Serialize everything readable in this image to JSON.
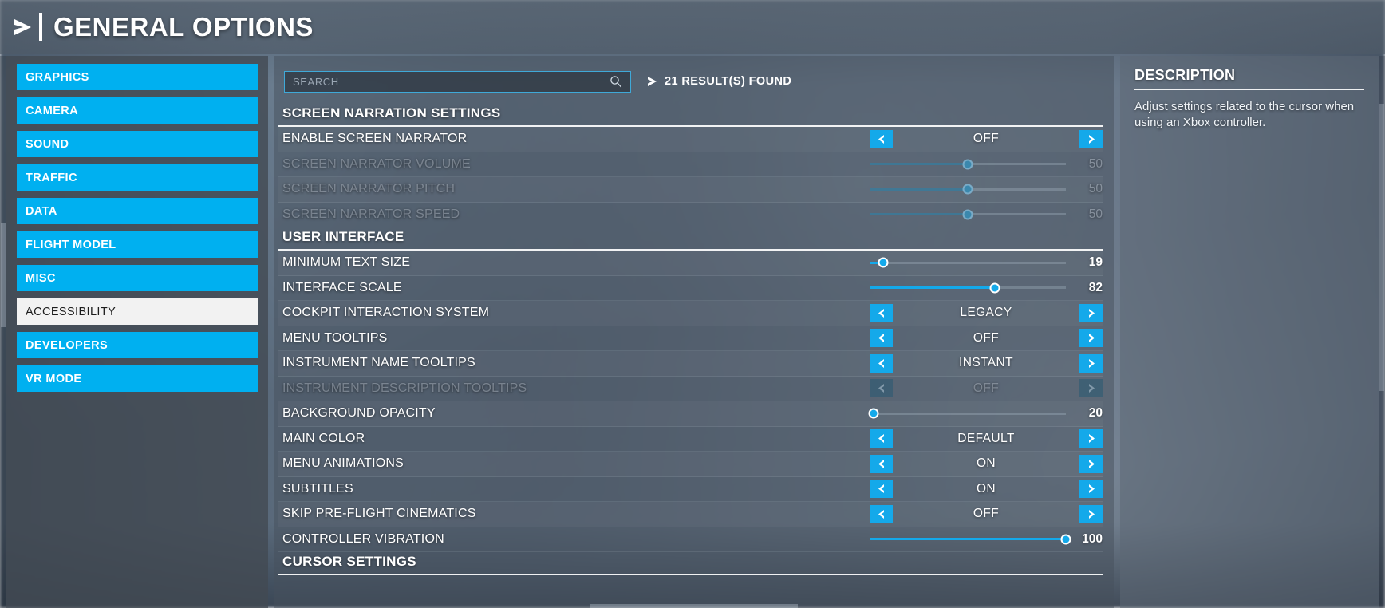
{
  "header": {
    "title": "GENERAL OPTIONS",
    "arrow_icon": "play-arrow-icon"
  },
  "sidebar": {
    "items": [
      {
        "label": "GRAPHICS",
        "selected": false
      },
      {
        "label": "CAMERA",
        "selected": false
      },
      {
        "label": "SOUND",
        "selected": false
      },
      {
        "label": "TRAFFIC",
        "selected": false
      },
      {
        "label": "DATA",
        "selected": false
      },
      {
        "label": "FLIGHT MODEL",
        "selected": false
      },
      {
        "label": "MISC",
        "selected": false
      },
      {
        "label": "ACCESSIBILITY",
        "selected": true
      },
      {
        "label": "DEVELOPERS",
        "selected": false
      },
      {
        "label": "VR MODE",
        "selected": false
      }
    ]
  },
  "search": {
    "value": "",
    "placeholder": "SEARCH",
    "icon": "search-icon",
    "results_label": "21 RESULT(S) FOUND",
    "results_chevron": "chevron-right-icon"
  },
  "sections": [
    {
      "title": "SCREEN NARRATION SETTINGS",
      "rows": [
        {
          "label": "ENABLE SCREEN NARRATOR",
          "type": "option",
          "value": "OFF",
          "disabled": false
        },
        {
          "label": "SCREEN NARRATOR VOLUME",
          "type": "slider",
          "value": 50,
          "percent": 50,
          "disabled": true
        },
        {
          "label": "SCREEN NARRATOR PITCH",
          "type": "slider",
          "value": 50,
          "percent": 50,
          "disabled": true
        },
        {
          "label": "SCREEN NARRATOR SPEED",
          "type": "slider",
          "value": 50,
          "percent": 50,
          "disabled": true
        }
      ]
    },
    {
      "title": "USER INTERFACE",
      "rows": [
        {
          "label": "MINIMUM TEXT SIZE",
          "type": "slider",
          "value": 19,
          "percent": 7,
          "disabled": false
        },
        {
          "label": "INTERFACE SCALE",
          "type": "slider",
          "value": 82,
          "percent": 64,
          "disabled": false
        },
        {
          "label": "COCKPIT INTERACTION SYSTEM",
          "type": "option",
          "value": "LEGACY",
          "disabled": false
        },
        {
          "label": "MENU TOOLTIPS",
          "type": "option",
          "value": "OFF",
          "disabled": false
        },
        {
          "label": "INSTRUMENT NAME TOOLTIPS",
          "type": "option",
          "value": "INSTANT",
          "disabled": false
        },
        {
          "label": "INSTRUMENT DESCRIPTION TOOLTIPS",
          "type": "option",
          "value": "OFF",
          "disabled": true
        },
        {
          "label": "BACKGROUND OPACITY",
          "type": "slider",
          "value": 20,
          "percent": 2,
          "disabled": false
        },
        {
          "label": "MAIN COLOR",
          "type": "option",
          "value": "DEFAULT",
          "disabled": false
        },
        {
          "label": "MENU ANIMATIONS",
          "type": "option",
          "value": "ON",
          "disabled": false
        },
        {
          "label": "SUBTITLES",
          "type": "option",
          "value": "ON",
          "disabled": false
        },
        {
          "label": "SKIP PRE-FLIGHT CINEMATICS",
          "type": "option",
          "value": "OFF",
          "disabled": false
        },
        {
          "label": "CONTROLLER VIBRATION",
          "type": "slider",
          "value": 100,
          "percent": 100,
          "disabled": false
        }
      ]
    },
    {
      "title": "CURSOR SETTINGS",
      "rows": []
    }
  ],
  "description": {
    "title": "DESCRIPTION",
    "body": "Adjust settings related to the cursor when using an Xbox controller."
  },
  "colors": {
    "accent": "#00b0f0",
    "accent_control": "#14a9ea",
    "selected_item_bg": "#f2f2f2",
    "text": "#ffffff"
  },
  "icons": {
    "left_arrow": "chevron-left-icon",
    "right_arrow": "chevron-right-icon"
  }
}
